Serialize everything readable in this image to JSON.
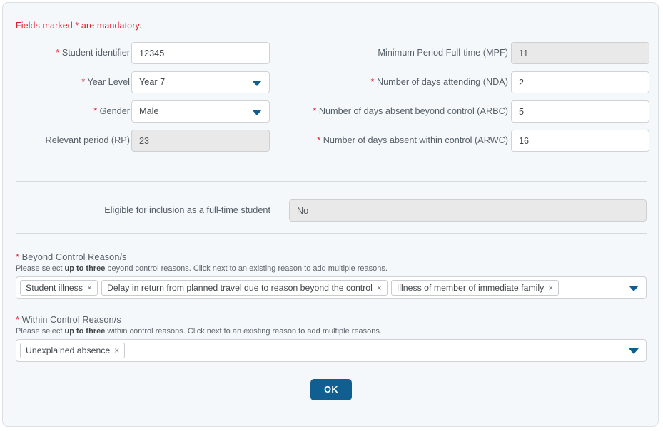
{
  "notice": "Fields marked * are mandatory.",
  "form": {
    "left_fields": [
      {
        "label": "Student identifier",
        "required": true,
        "value": "12345",
        "type": "text",
        "disabled": false
      },
      {
        "label": "Year Level",
        "required": true,
        "value": "Year 7",
        "type": "select",
        "disabled": false
      },
      {
        "label": "Gender",
        "required": true,
        "value": "Male",
        "type": "select",
        "disabled": false
      },
      {
        "label": "Relevant period (RP)",
        "required": false,
        "value": "23",
        "type": "text",
        "disabled": true
      }
    ],
    "right_fields": [
      {
        "label": "Minimum Period Full-time (MPF)",
        "required": false,
        "value": "11",
        "type": "text",
        "disabled": true
      },
      {
        "label": "Number of days attending (NDA)",
        "required": true,
        "value": "2",
        "type": "text",
        "disabled": false
      },
      {
        "label": "Number of days absent beyond control (ARBC)",
        "required": true,
        "value": "5",
        "type": "text",
        "disabled": false
      },
      {
        "label": "Number of days absent within control (ARWC)",
        "required": true,
        "value": "16",
        "type": "text",
        "disabled": false
      }
    ]
  },
  "eligible": {
    "label": "Eligible for inclusion as a full-time student",
    "value": "No"
  },
  "beyond_control": {
    "title": "Beyond Control Reason/s",
    "required": true,
    "help_prefix": "Please select ",
    "help_bold": "up to three",
    "help_suffix": " beyond control reasons. Click next to an existing reason to add multiple reasons.",
    "chips": [
      "Student illness",
      "Delay in return from planned travel due to reason beyond the control",
      "Illness of member of immediate family"
    ],
    "remove_glyph": "×"
  },
  "within_control": {
    "title": "Within Control Reason/s",
    "required": true,
    "help_prefix": "Please select ",
    "help_bold": "up to three",
    "help_suffix": " within control reasons. Click next to an existing reason to add multiple reasons.",
    "chips": [
      "Unexplained absence"
    ],
    "remove_glyph": "×"
  },
  "footer": {
    "ok_label": "OK"
  },
  "colors": {
    "panel_bg": "#f4f8fb",
    "accent": "#115f90",
    "required_red": "#e8192c",
    "label_gray": "#565e66",
    "disabled_bg": "#e9e9e9"
  }
}
